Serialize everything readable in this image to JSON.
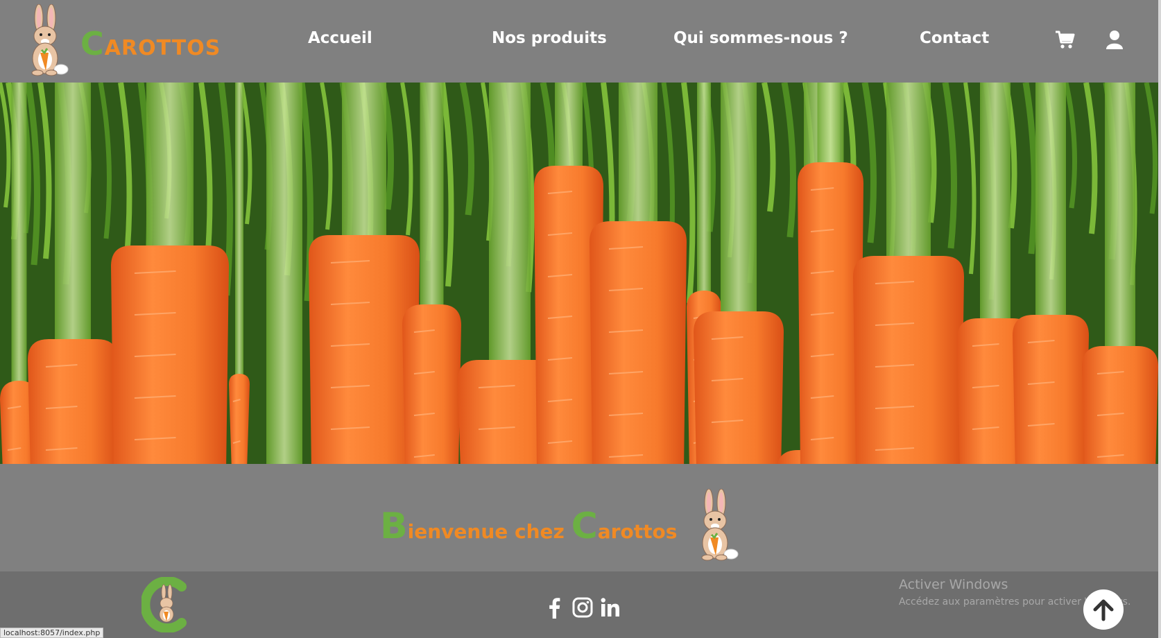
{
  "header": {
    "brand_initial": "C",
    "brand_rest": "arottos",
    "nav": [
      "Accueil",
      "Nos produits",
      "Qui sommes-nous ?",
      "Contact"
    ],
    "icons": [
      "cart-icon",
      "user-icon"
    ]
  },
  "hero": {
    "image": "carrots-bunch-photo"
  },
  "welcome": {
    "title_initial_1": "B",
    "title_part_1": "ienvenue chez ",
    "title_initial_2": "C",
    "title_part_2": "arottos"
  },
  "footer": {
    "social_icons": [
      "facebook-icon",
      "instagram-icon",
      "linkedin-icon"
    ],
    "watermark_title": "Activer Windows",
    "watermark_sub": "Accédez aux paramètres pour activer Windows.",
    "status_url": "localhost:8057/index.php"
  },
  "colors": {
    "background": "#808080",
    "footer": "#6e6e6e",
    "orange": "#f08a24",
    "green": "#6cb043"
  }
}
